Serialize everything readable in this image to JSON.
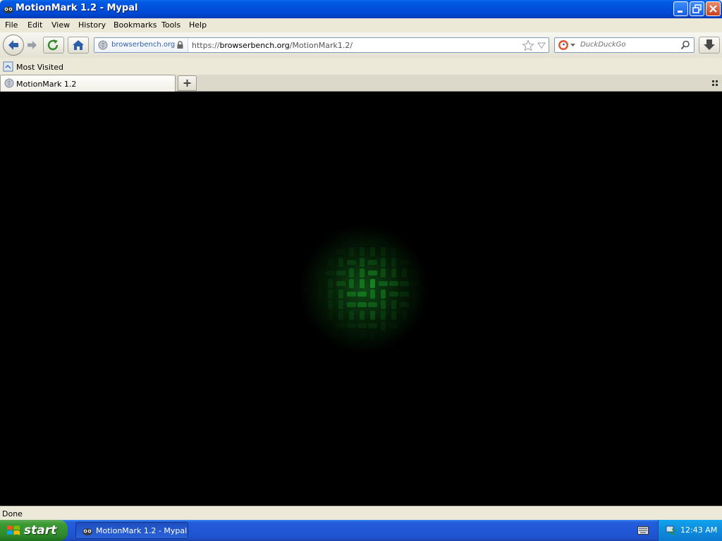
{
  "window": {
    "title": "MotionMark 1.2 - Mypal"
  },
  "menu": {
    "items": [
      {
        "label": "File"
      },
      {
        "label": "Edit"
      },
      {
        "label": "View"
      },
      {
        "label": "History"
      },
      {
        "label": "Bookmarks"
      },
      {
        "label": "Tools"
      },
      {
        "label": "Help"
      }
    ]
  },
  "navbar": {
    "identity_label": "browserbench.org",
    "url_prefix": "https://",
    "url_host": "browserbench.org",
    "url_path": "/MotionMark1.2/",
    "search_placeholder": "DuckDuckGo"
  },
  "bookmarks": {
    "most_visited": "Most Visited"
  },
  "tabs": [
    {
      "label": "MotionMark 1.2"
    }
  ],
  "status": {
    "text": "Done"
  },
  "taskbar": {
    "start_label": "start",
    "task_label": "MotionMark 1.2 - Mypal",
    "clock": "12:43 AM"
  },
  "colors": {
    "title_bar": "#0054e3",
    "content_bg": "#000000",
    "glow": "#1e8a28",
    "taskbar": "#245edb",
    "start_button": "#3c9a34"
  }
}
